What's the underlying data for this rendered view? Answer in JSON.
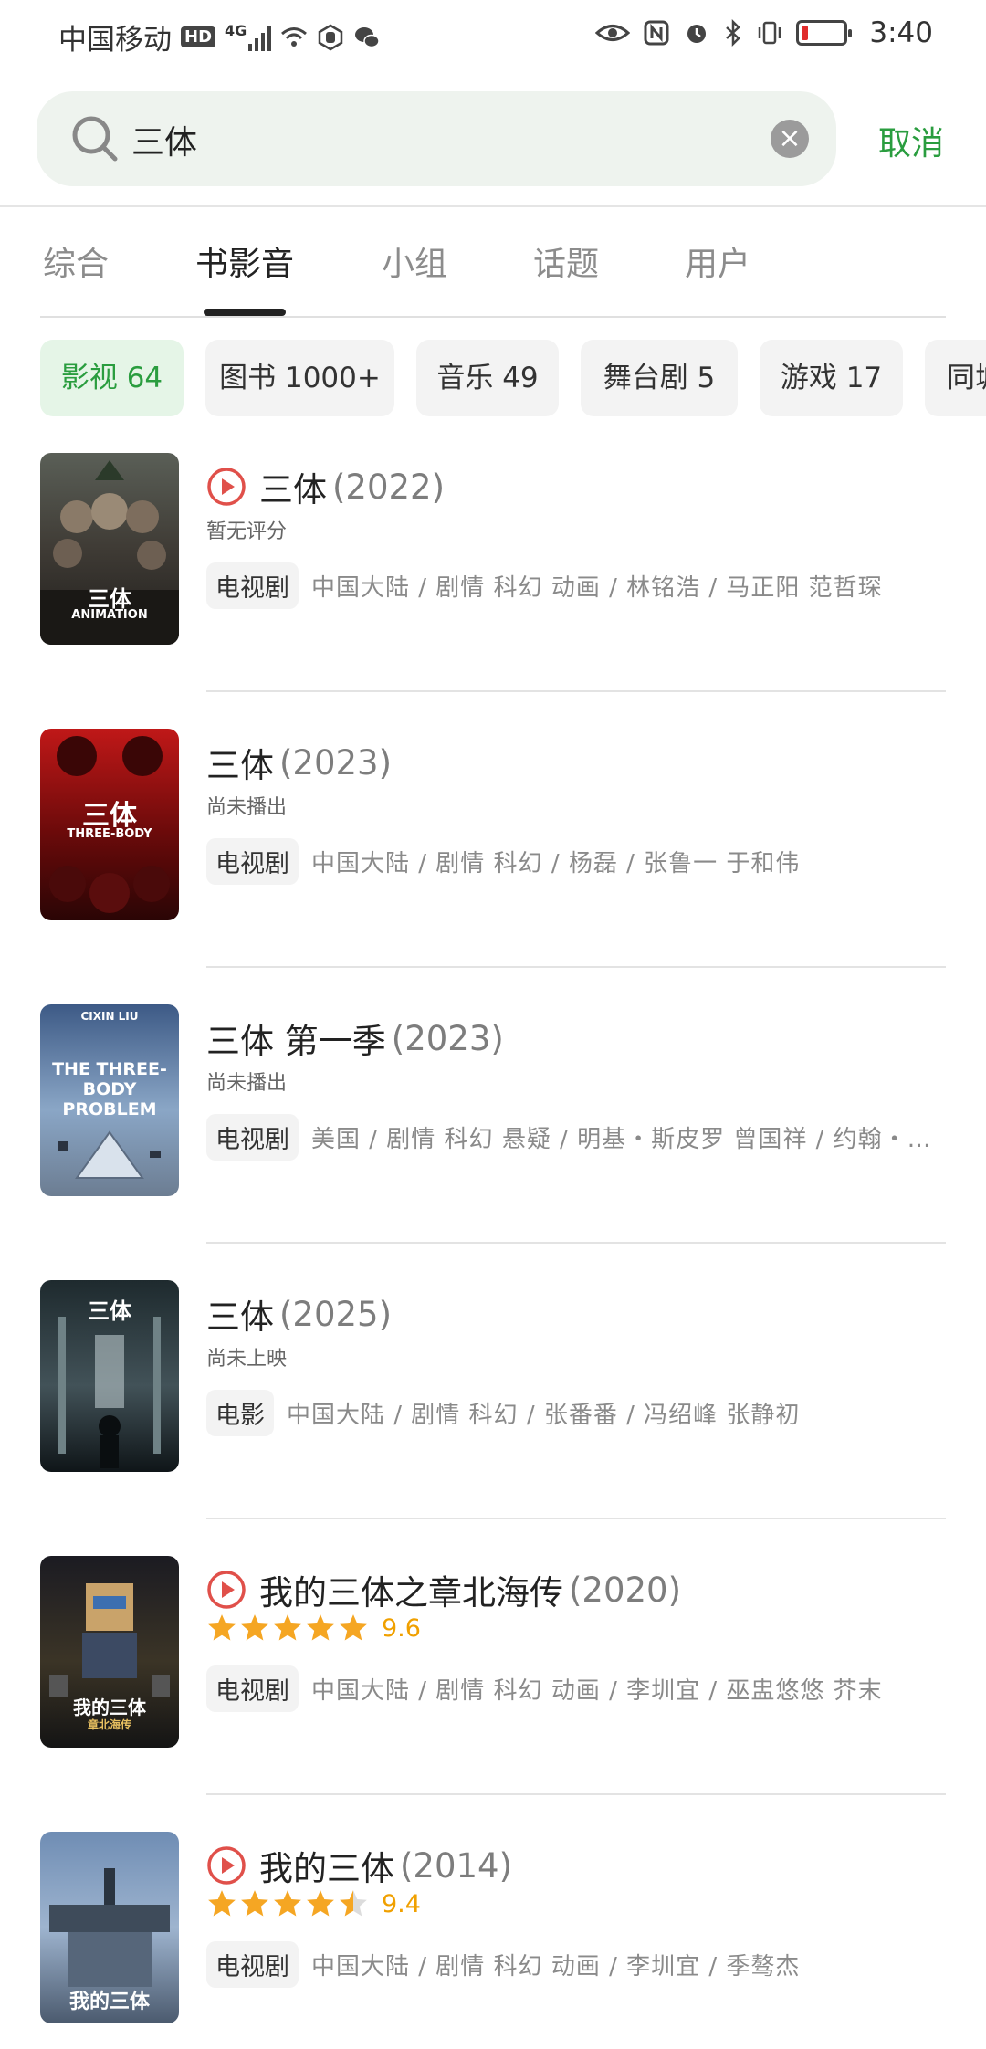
{
  "status_bar": {
    "carrier": "中国移动",
    "network": "4G",
    "time": "3:40"
  },
  "search": {
    "query": "三体",
    "cancel_label": "取消"
  },
  "tabs": [
    {
      "label": "综合"
    },
    {
      "label": "书影音"
    },
    {
      "label": "小组"
    },
    {
      "label": "话题"
    },
    {
      "label": "用户"
    }
  ],
  "active_tab": "书影音",
  "chips": [
    {
      "label": "影视 64"
    },
    {
      "label": "图书 1000+"
    },
    {
      "label": "音乐 49"
    },
    {
      "label": "舞台剧 5"
    },
    {
      "label": "游戏 17"
    },
    {
      "label": "同城"
    }
  ],
  "results": [
    {
      "title": "三体",
      "year": "(2022)",
      "playable": true,
      "subtitle": "暂无评分",
      "type_tag": "电视剧",
      "meta": "中国大陆 / 剧情 科幻 动画 / 林铭浩 / 马正阳 范哲琛",
      "poster_text": "三体",
      "poster_sub": "ANIMATION"
    },
    {
      "title": "三体",
      "year": "(2023)",
      "playable": false,
      "subtitle": "尚未播出",
      "type_tag": "电视剧",
      "meta": "中国大陆 / 剧情 科幻 / 杨磊 / 张鲁一 于和伟",
      "poster_text": "三体",
      "poster_sub": "THREE-BODY"
    },
    {
      "title": "三体 第一季",
      "year": "(2023)",
      "playable": false,
      "subtitle": "尚未播出",
      "type_tag": "电视剧",
      "meta": "美国 / 剧情 科幻 悬疑 / 明基・斯皮罗 曾国祥 / 约翰・…",
      "poster_text": "THE THREE-BODY PROBLEM",
      "poster_sub": "CIXIN LIU"
    },
    {
      "title": "三体",
      "year": "(2025)",
      "playable": false,
      "subtitle": "尚未上映",
      "type_tag": "电影",
      "meta": "中国大陆 / 剧情 科幻 / 张番番 / 冯绍峰 张静初",
      "poster_text": "三体",
      "poster_sub": ""
    },
    {
      "title": "我的三体之章北海传",
      "year": "(2020)",
      "playable": true,
      "score": "9.6",
      "stars": 5,
      "type_tag": "电视剧",
      "meta": "中国大陆 / 剧情 科幻 动画 / 李圳宜 / 巫盅悠悠 芥末",
      "poster_text": "我的三体",
      "poster_sub": "章北海传"
    },
    {
      "title": "我的三体",
      "year": "(2014)",
      "playable": true,
      "score": "9.4",
      "stars": 4.5,
      "type_tag": "电视剧",
      "meta": "中国大陆 / 剧情 科幻 动画 / 李圳宜 / 季骜杰",
      "poster_text": "我的三体",
      "poster_sub": ""
    }
  ],
  "colors": {
    "accent_green": "#2a9d3f",
    "star": "#f5a623",
    "play_red": "#e0504a"
  }
}
